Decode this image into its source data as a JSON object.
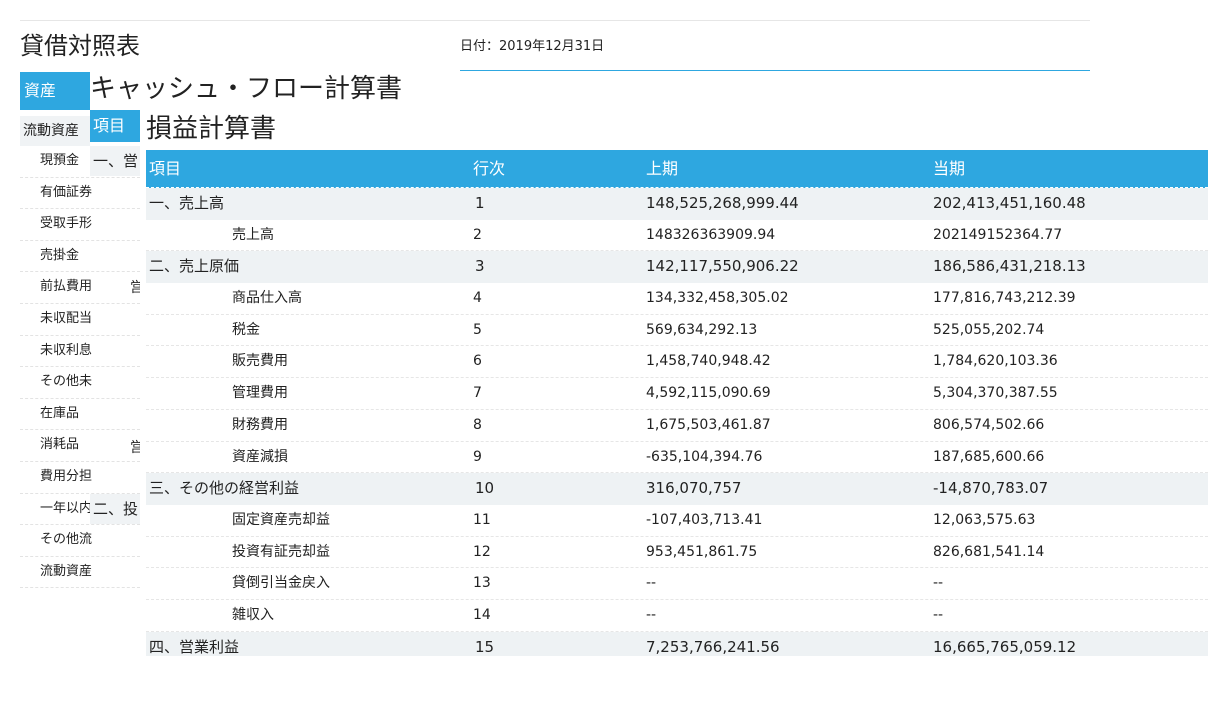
{
  "balance_sheet": {
    "title": "貸借対照表",
    "date": "日付：2019年12月31日",
    "asset_header": "資産",
    "current_assets_header": "流動資産",
    "items": [
      "現預金",
      "有価証券",
      "受取手形",
      "売掛金",
      "前払費用",
      "未収配当",
      "未収利息",
      "その他未",
      "在庫品",
      "消耗品",
      "費用分担",
      "一年以内",
      "その他流",
      "流動資産"
    ]
  },
  "cash_flow": {
    "title": "キャッシュ・フロー計算書",
    "header": "項目",
    "section1": "一、営",
    "section2": "二、投",
    "fragment": "営"
  },
  "income_statement": {
    "title": "損益計算書",
    "columns": {
      "item": "項目",
      "no": "行次",
      "prev": "上期",
      "cur": "当期"
    },
    "rows": [
      {
        "type": "sec",
        "name": "一、売上高",
        "no": "1",
        "prev": "148,525,268,999.44",
        "cur": "202,413,451,160.48"
      },
      {
        "type": "det",
        "name": "売上高",
        "no": "2",
        "prev": "148326363909.94",
        "cur": "202149152364.77"
      },
      {
        "type": "sec",
        "name": "二、売上原価",
        "no": "3",
        "prev": "142,117,550,906.22",
        "cur": "186,586,431,218.13"
      },
      {
        "type": "det",
        "name": "商品仕入高",
        "no": "4",
        "prev": "134,332,458,305.02",
        "cur": "177,816,743,212.39"
      },
      {
        "type": "det",
        "name": "税金",
        "no": "5",
        "prev": "569,634,292.13",
        "cur": "525,055,202.74"
      },
      {
        "type": "det",
        "name": "販売費用",
        "no": "6",
        "prev": "1,458,740,948.42",
        "cur": "1,784,620,103.36"
      },
      {
        "type": "det",
        "name": "管理費用",
        "no": "7",
        "prev": "4,592,115,090.69",
        "cur": "5,304,370,387.55"
      },
      {
        "type": "det",
        "name": "財務費用",
        "no": "8",
        "prev": "1,675,503,461.87",
        "cur": "806,574,502.66"
      },
      {
        "type": "det",
        "name": "資産減損",
        "no": "9",
        "prev": "-635,104,394.76",
        "cur": "187,685,600.66"
      },
      {
        "type": "sec",
        "name": "三、その他の経営利益",
        "no": "10",
        "prev": "316,070,757",
        "cur": "-14,870,783.07"
      },
      {
        "type": "det",
        "name": "固定資産売却益",
        "no": "11",
        "prev": "-107,403,713.41",
        "cur": "12,063,575.63"
      },
      {
        "type": "det",
        "name": "投資有証売却益",
        "no": "12",
        "prev": "953,451,861.75",
        "cur": "826,681,541.14"
      },
      {
        "type": "det",
        "name": "貸倒引当金戻入",
        "no": "13",
        "prev": "--",
        "cur": "--"
      },
      {
        "type": "det",
        "name": "雑収入",
        "no": "14",
        "prev": "--",
        "cur": "--"
      },
      {
        "type": "sec",
        "name": "四、営業利益",
        "no": "15",
        "prev": "7,253,766,241.56",
        "cur": "16,665,765,059.12"
      }
    ]
  }
}
